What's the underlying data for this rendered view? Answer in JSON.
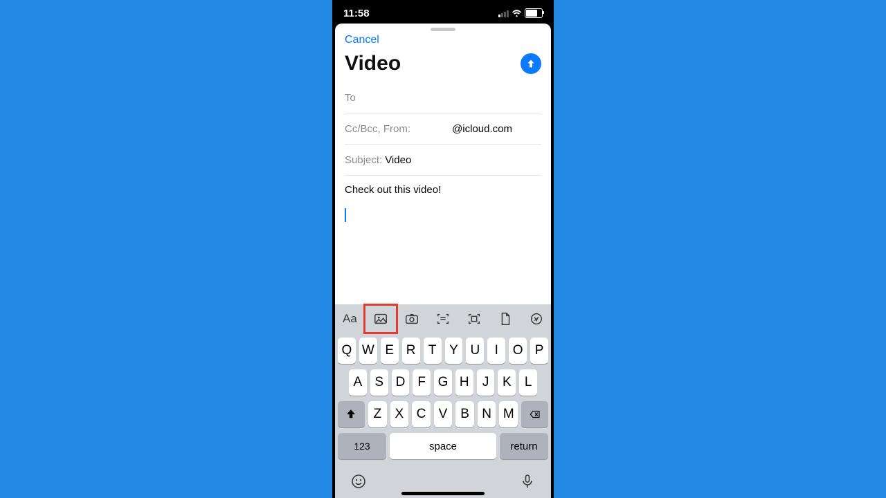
{
  "status": {
    "time": "11:58"
  },
  "compose": {
    "cancel": "Cancel",
    "title": "Video",
    "to_label": "To",
    "ccbcc_from_label": "Cc/Bcc, From:",
    "from_address": "@icloud.com",
    "subject_label": "Subject:",
    "subject_value": "Video",
    "body": "Check out this video!"
  },
  "keyboard": {
    "row1": [
      "Q",
      "W",
      "E",
      "R",
      "T",
      "Y",
      "U",
      "I",
      "O",
      "P"
    ],
    "row2": [
      "A",
      "S",
      "D",
      "F",
      "G",
      "H",
      "J",
      "K",
      "L"
    ],
    "row3": [
      "Z",
      "X",
      "C",
      "V",
      "B",
      "N",
      "M"
    ],
    "mode_key": "123",
    "space_key": "space",
    "return_key": "return"
  },
  "format_bar": {
    "text_format": "Aa"
  }
}
